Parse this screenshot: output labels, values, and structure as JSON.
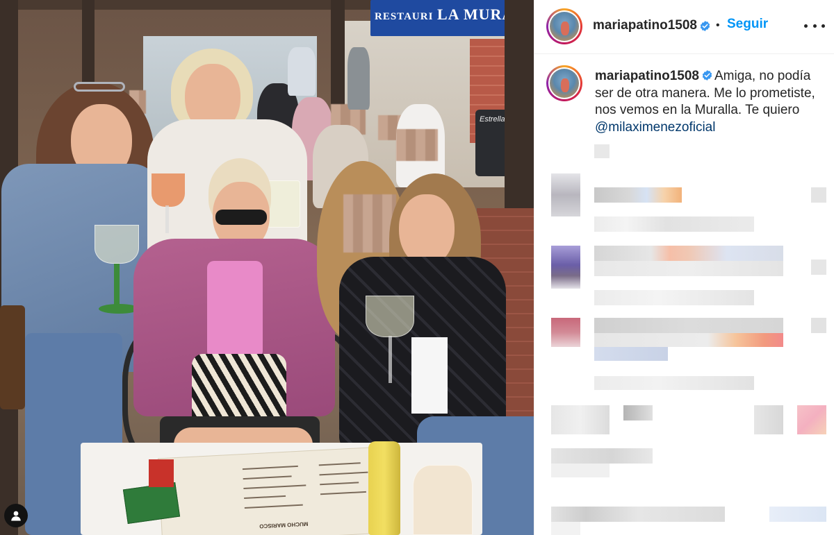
{
  "photo": {
    "restaurant_sign": "RESTAURI",
    "restaurant_sign_2": "LA MURALL",
    "barrel_label": "Estrella Gali",
    "menu_title": "MUCHO MARISCO"
  },
  "post": {
    "header": {
      "username": "mariapatino1508",
      "separator": "•",
      "follow_label": "Seguir"
    },
    "caption": {
      "username": "mariapatino1508",
      "text": "Amiga, no podía ser de otra manera. Me lo prometiste, nos vemos en la Muralla. Te quiero ",
      "mention": "@milaximenezoficial"
    }
  },
  "colors": {
    "accent": "#0095f6",
    "mention": "#00376b",
    "verified": "#3897f0",
    "text": "#262626"
  },
  "icons": {
    "verified": "verified-badge-icon",
    "more": "more-options-icon",
    "user_tag": "user-tag-icon"
  }
}
